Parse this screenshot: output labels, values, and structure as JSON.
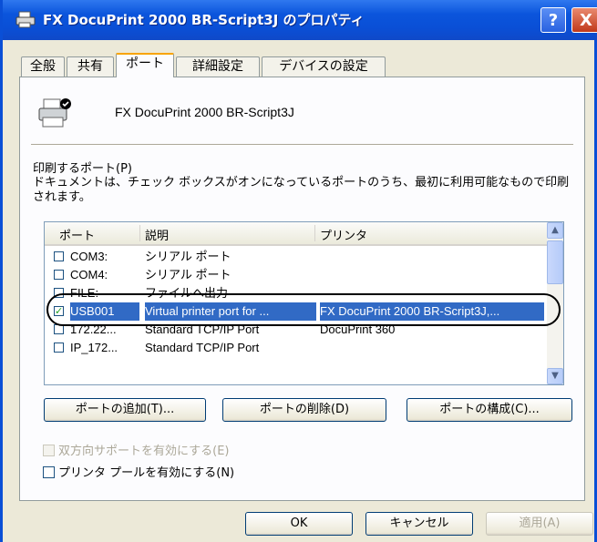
{
  "window": {
    "title": "FX DocuPrint 2000 BR-Script3J のプロパティ",
    "help_label": "?",
    "close_label": "X"
  },
  "tabs": [
    {
      "label": "全般"
    },
    {
      "label": "共有"
    },
    {
      "label": "ポート",
      "active": true
    },
    {
      "label": "詳細設定"
    },
    {
      "label": "デバイスの設定"
    }
  ],
  "printer_name": "FX DocuPrint 2000 BR-Script3J",
  "ports_heading": "印刷するポート(P)",
  "ports_description": "ドキュメントは、チェック ボックスがオンになっているポートのうち、最初に利用可能なもので印刷されます。",
  "port_list": {
    "columns": [
      "ポート",
      "説明",
      "プリンタ"
    ],
    "rows": [
      {
        "port": "COM3:",
        "description": "シリアル ポート",
        "printer": "",
        "checked": false
      },
      {
        "port": "COM4:",
        "description": "シリアル ポート",
        "printer": "",
        "checked": false
      },
      {
        "port": "FILE:",
        "description": "ファイルへ出力",
        "printer": "",
        "checked": false
      },
      {
        "port": "USB001",
        "description": "Virtual printer port for ...",
        "printer": "FX DocuPrint 2000 BR-Script3J,...",
        "checked": true,
        "selected": true
      },
      {
        "port": "172.22...",
        "description": "Standard TCP/IP Port",
        "printer": "DocuPrint 360",
        "checked": false
      },
      {
        "port": "IP_172...",
        "description": "Standard TCP/IP Port",
        "printer": "",
        "checked": false
      }
    ]
  },
  "buttons": {
    "add_port": "ポートの追加(T)...",
    "delete_port": "ポートの削除(D)",
    "configure_port": "ポートの構成(C)..."
  },
  "options": {
    "bidirectional": "双方向サポートを有効にする(E)",
    "printer_pool": "プリンタ プールを有効にする(N)"
  },
  "footer": {
    "ok": "OK",
    "cancel": "キャンセル",
    "apply": "適用(A)"
  },
  "colors": {
    "title_bar": "#0a4fd6",
    "dialog_bg": "#ece9d8",
    "selection": "#316ac5",
    "tab_accent": "#f8a400"
  }
}
